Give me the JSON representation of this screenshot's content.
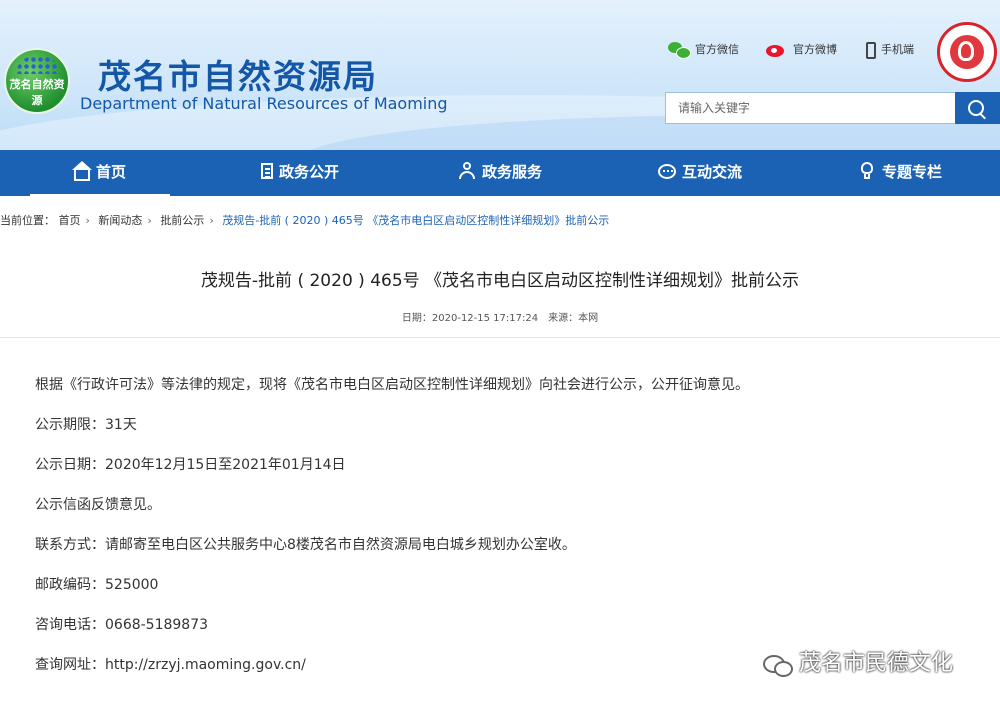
{
  "header": {
    "logo_text": "茂名自然资源",
    "site_title": "茂名市自然资源局",
    "site_subtitle": "Department of Natural Resources of Maoming",
    "top_links": [
      {
        "label": "官方微信",
        "icon": "wechat-icon"
      },
      {
        "label": "官方微博",
        "icon": "weibo-icon"
      },
      {
        "label": "手机端",
        "icon": "mobile-phone-icon"
      }
    ],
    "search_placeholder": "请输入关键字"
  },
  "nav": {
    "items": [
      {
        "label": "首页",
        "icon": "home-icon",
        "active": true
      },
      {
        "label": "政务公开",
        "icon": "document-icon"
      },
      {
        "label": "政务服务",
        "icon": "service-person-icon"
      },
      {
        "label": "互动交流",
        "icon": "chat-icon"
      },
      {
        "label": "专题专栏",
        "icon": "topic-icon"
      }
    ]
  },
  "breadcrumb": {
    "prefix": "当前位置：",
    "items": [
      "首页",
      "新闻动态",
      "批前公示"
    ],
    "current": "茂规告-批前 ( 2020 ) 465号 《茂名市电白区启动区控制性详细规划》批前公示"
  },
  "article": {
    "title": "茂规告-批前 ( 2020 ) 465号 《茂名市电白区启动区控制性详细规划》批前公示",
    "date_label": "日期：",
    "date": "2020-12-15 17:17:24",
    "source_label": "来源：",
    "source": "本网",
    "paragraphs": [
      "根据《行政许可法》等法律的规定，现将《茂名市电白区启动区控制性详细规划》向社会进行公示，公开征询意见。",
      "公示期限：31天",
      "公示日期：2020年12月15日至2021年01月14日",
      "公示信函反馈意见。",
      "联系方式：请邮寄至电白区公共服务中心8楼茂名市自然资源局电白城乡规划办公室收。",
      "邮政编码：525000",
      "咨询电话：0668-5189873",
      "查询网址：http://zrzyj.maoming.gov.cn/"
    ]
  },
  "watermark": {
    "text": "茂名市民德文化"
  },
  "colors": {
    "brand_blue": "#1b62b5",
    "title_blue": "#1557a7",
    "weibo_red": "#e6162d",
    "wechat_green": "#3cb034"
  }
}
